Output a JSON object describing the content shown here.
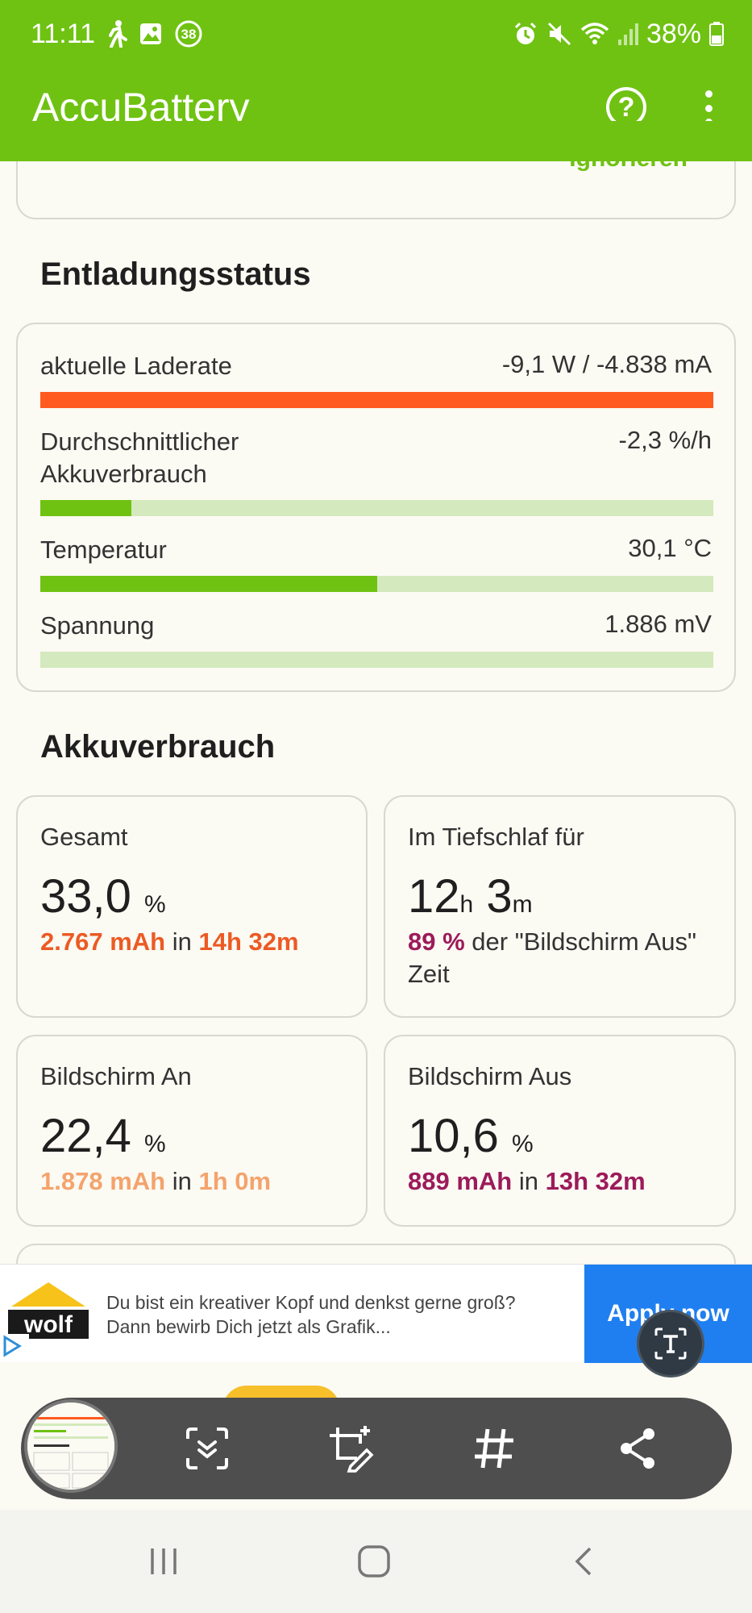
{
  "status_bar": {
    "time": "11:11",
    "left_icons": [
      "walk-icon",
      "image-icon",
      "badge-38-icon"
    ],
    "badge_text": "38",
    "right_icons": [
      "alarm-icon",
      "mute-icon",
      "wifi-icon",
      "signal-icon",
      "battery-icon"
    ],
    "battery": "38%"
  },
  "app_bar": {
    "title": "AccuBattery",
    "help_icon": "help-circle-icon",
    "menu_icon": "more-vert-icon",
    "color": "#6fc212"
  },
  "top_card": {
    "ignore_label": "Ignorieren"
  },
  "discharge": {
    "title": "Entladungsstatus",
    "rows": [
      {
        "label": "aktuelle Laderate",
        "value": "-9,1 W / -4.838 mA",
        "fill": 1.0,
        "color": "#ff5a1f"
      },
      {
        "label": "Durchschnittlicher Akkuverbrauch",
        "value": "-2,3 %/h",
        "fill": 0.135,
        "color": "#6fc212"
      },
      {
        "label": "Temperatur",
        "value": "30,1 °C",
        "fill": 0.5,
        "color": "#6fc212"
      },
      {
        "label": "Spannung",
        "value": "1.886 mV",
        "fill": 0.0,
        "color": "#6fc212"
      }
    ]
  },
  "usage": {
    "title": "Akkuverbrauch",
    "total": {
      "label": "Gesamt",
      "value": "33,0",
      "unit": "%",
      "mah": "2.767 mAh",
      "in": "in",
      "duration": "14h 32m",
      "color": "#ec5a24"
    },
    "deep_sleep": {
      "label": "Im Tiefschlaf für",
      "hours": "12",
      "h": "h",
      "minutes": "3",
      "m": "m",
      "pct": "89 %",
      "desc": "der \"Bildschirm Aus\" Zeit",
      "color": "#9c1b5a"
    },
    "screen_on": {
      "label": "Bildschirm An",
      "value": "22,4",
      "unit": "%",
      "mah": "1.878 mAh",
      "in": "in",
      "duration": "1h 0m",
      "color": "#f4a36c"
    },
    "screen_off": {
      "label": "Bildschirm Aus",
      "value": "10,6",
      "unit": "%",
      "mah": "889 mAh",
      "in": "in",
      "duration": "13h 32m",
      "color": "#9c1b5a"
    }
  },
  "ad": {
    "line1": "Du bist ein kreativer Kopf und denkst gerne groß?",
    "line2": "Dann bewirb Dich jetzt als Grafik...",
    "cta": "Apply now",
    "logo_text": "wolf"
  },
  "screenshot_toolbar": {
    "buttons": [
      "scroll-capture-icon",
      "edit-crop-icon",
      "hashtag-icon",
      "share-icon"
    ]
  },
  "nav": {
    "buttons": [
      "recents-icon",
      "home-icon",
      "back-icon"
    ]
  }
}
